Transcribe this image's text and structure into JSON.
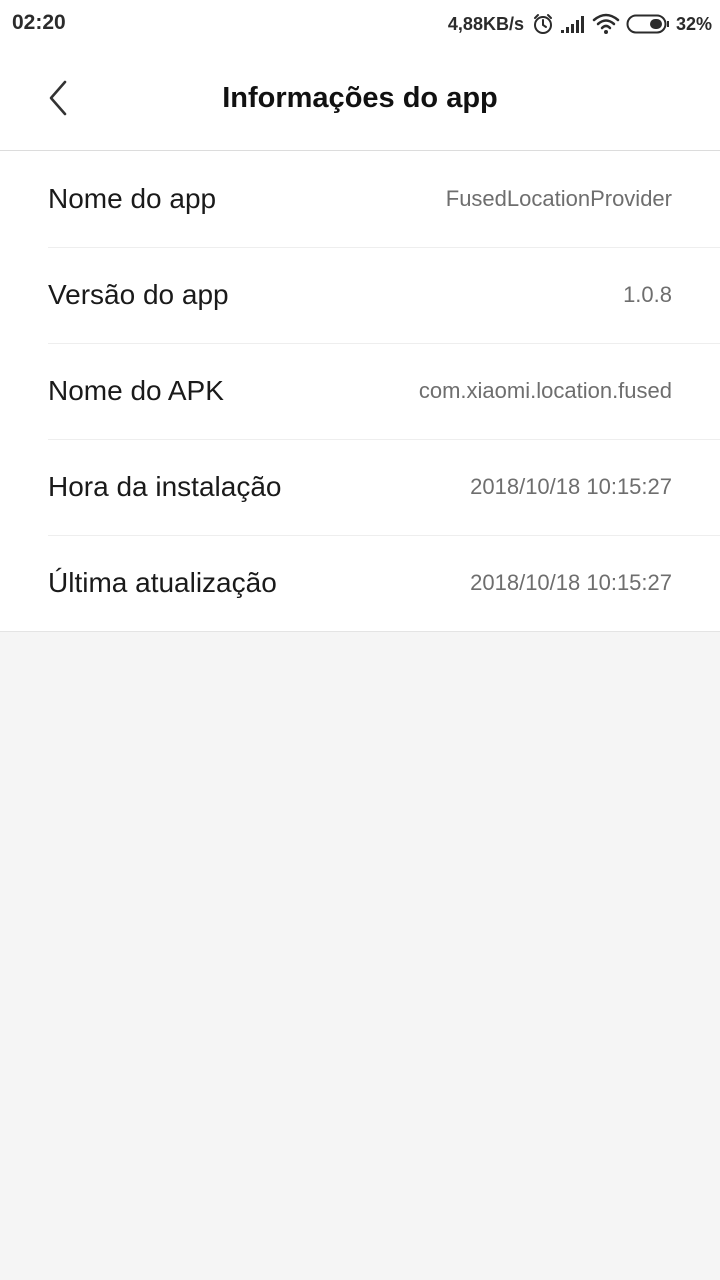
{
  "status_bar": {
    "time": "02:20",
    "network_speed": "4,88KB/s",
    "battery_percent": "32%",
    "icons": [
      "alarm-icon",
      "signal-icon",
      "wifi-icon",
      "battery-icon"
    ]
  },
  "header": {
    "title": "Informações do app",
    "back_icon": "chevron-left-icon"
  },
  "app_info": {
    "rows": [
      {
        "label": "Nome do app",
        "value": "FusedLocationProvider"
      },
      {
        "label": "Versão do app",
        "value": "1.0.8"
      },
      {
        "label": "Nome do APK",
        "value": "com.xiaomi.location.fused"
      },
      {
        "label": "Hora da instalação",
        "value": "2018/10/18 10:15:27"
      },
      {
        "label": "Última atualização",
        "value": "2018/10/18 10:15:27"
      }
    ]
  },
  "colors": {
    "background": "#f5f5f5",
    "surface": "#ffffff",
    "label_text": "#1a1a1a",
    "value_text": "#6e6e6e"
  }
}
